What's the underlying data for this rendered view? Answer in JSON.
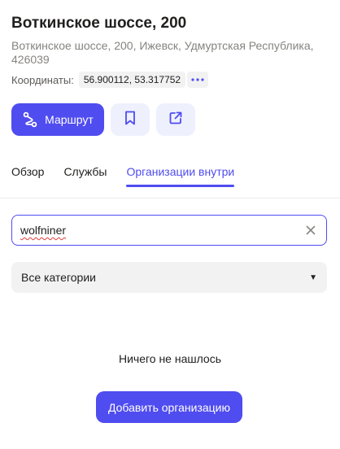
{
  "header": {
    "title": "Воткинское шоссе, 200",
    "address": "Воткинское шоссе, 200, Ижевск, Удмуртская Республика, 426039",
    "coords_label": "Координаты:",
    "coords_value": "56.900112, 53.317752",
    "coords_more_icon": "more-dots-icon"
  },
  "actions": {
    "route_label": "Маршрут",
    "route_icon": "route-icon",
    "bookmark_icon": "bookmark-icon",
    "share_icon": "share-icon"
  },
  "tabs": [
    {
      "label": "Обзор",
      "active": false
    },
    {
      "label": "Службы",
      "active": false
    },
    {
      "label": "Организации внутри",
      "active": true
    }
  ],
  "search": {
    "value": "wolfniner",
    "clear_icon": "close-icon"
  },
  "category": {
    "selected": "Все категории"
  },
  "empty_state": {
    "message": "Ничего не нашлось",
    "add_button_label": "Добавить организацию"
  },
  "colors": {
    "accent": "#4f4cf0",
    "secondary_button_bg": "#eef0fe",
    "muted_text": "#85847f"
  }
}
